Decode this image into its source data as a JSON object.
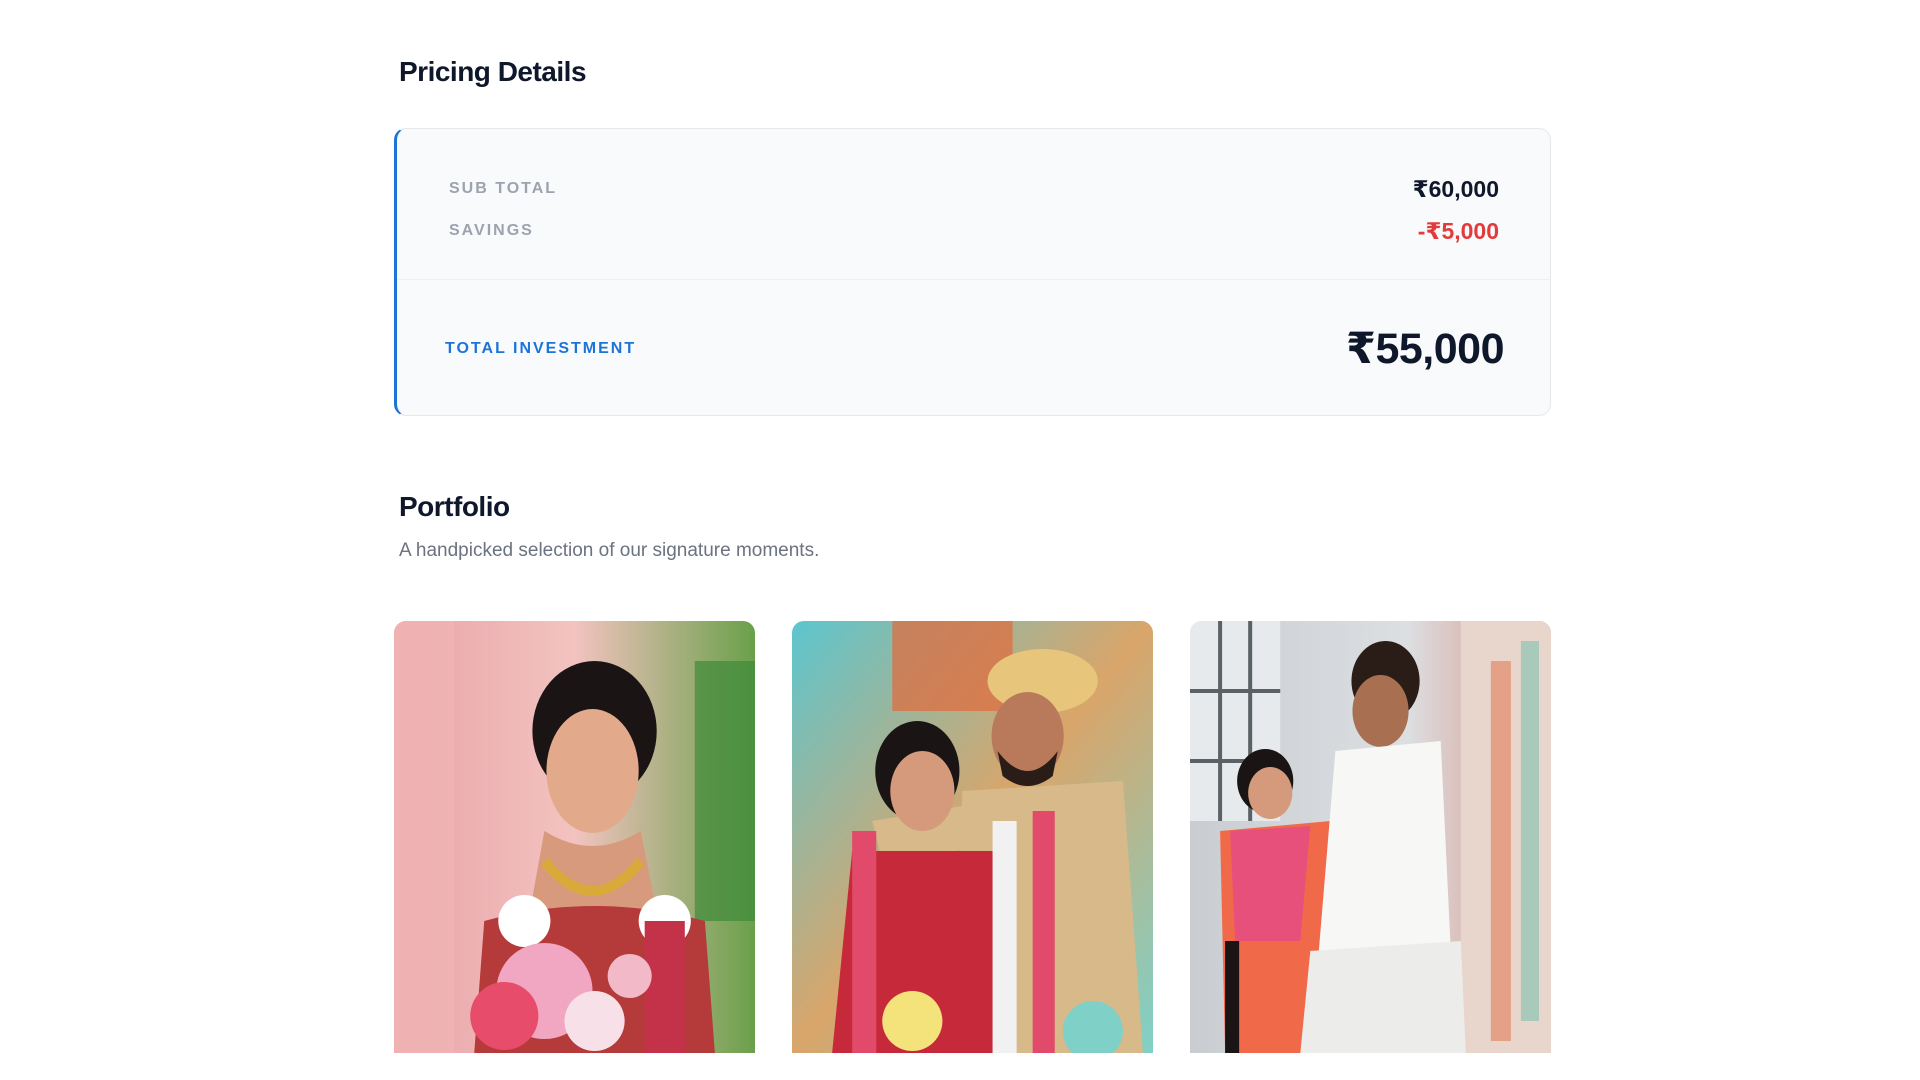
{
  "pricing": {
    "title": "Pricing Details",
    "sub_total_label": "SUB TOTAL",
    "sub_total_value": "₹60,000",
    "savings_label": "SAVINGS",
    "savings_value": "-₹5,000",
    "total_label": "TOTAL INVESTMENT",
    "total_value": "₹55,000"
  },
  "portfolio": {
    "title": "Portfolio",
    "subtitle": "A handpicked selection of our signature moments.",
    "photos": [
      {
        "icon": "bride-portrait-photo"
      },
      {
        "icon": "couple-garland-photo"
      },
      {
        "icon": "couple-laughing-photo"
      }
    ]
  },
  "colors": {
    "accent": "#1d74d8",
    "negative": "#e23b3b",
    "card_bg": "#f8fafc",
    "muted_text": "#9ca3af"
  }
}
